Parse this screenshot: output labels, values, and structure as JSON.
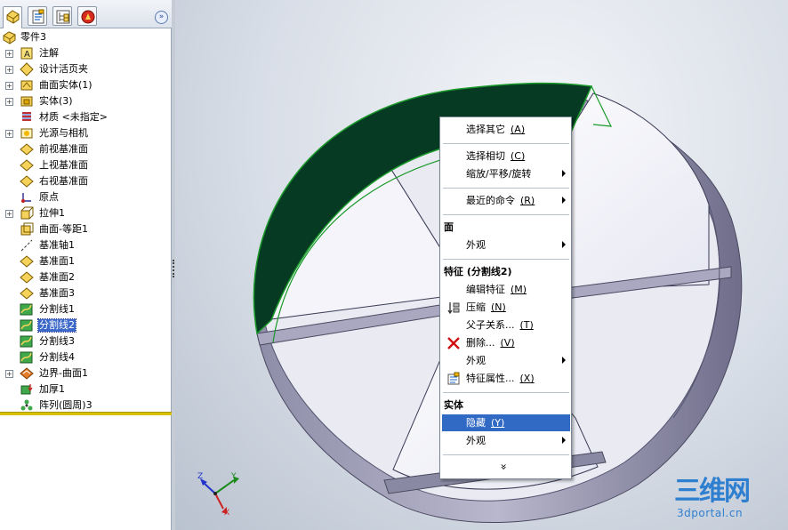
{
  "panel": {
    "tabs": [
      {
        "icon": "feature-manager-icon"
      },
      {
        "icon": "property-manager-icon"
      },
      {
        "icon": "configuration-manager-icon"
      },
      {
        "icon": "appearance-manager-icon"
      }
    ],
    "expand_glyph": "»",
    "tree": {
      "root": "零件3",
      "items": [
        {
          "label": "注解",
          "icon": "annotation-icon",
          "expandable": true
        },
        {
          "label": "设计活页夹",
          "icon": "design-binder-icon",
          "expandable": true
        },
        {
          "label": "曲面实体(1)",
          "icon": "surface-bodies-icon",
          "expandable": true
        },
        {
          "label": "实体(3)",
          "icon": "solid-bodies-icon",
          "expandable": true
        },
        {
          "label": "材质 <未指定>",
          "icon": "material-icon",
          "expandable": false
        },
        {
          "label": "光源与相机",
          "icon": "lights-cameras-icon",
          "expandable": true
        },
        {
          "label": "前视基准面",
          "icon": "plane-icon",
          "expandable": false
        },
        {
          "label": "上视基准面",
          "icon": "plane-icon",
          "expandable": false
        },
        {
          "label": "右视基准面",
          "icon": "plane-icon",
          "expandable": false
        },
        {
          "label": "原点",
          "icon": "origin-icon",
          "expandable": false
        },
        {
          "label": "拉伸1",
          "icon": "extrude-icon",
          "expandable": true
        },
        {
          "label": "曲面-等距1",
          "icon": "offset-surface-icon",
          "expandable": false
        },
        {
          "label": "基准轴1",
          "icon": "axis-icon",
          "expandable": false
        },
        {
          "label": "基准面1",
          "icon": "plane-icon",
          "expandable": false
        },
        {
          "label": "基准面2",
          "icon": "plane-icon",
          "expandable": false
        },
        {
          "label": "基准面3",
          "icon": "plane-icon",
          "expandable": false
        },
        {
          "label": "分割线1",
          "icon": "split-line-icon",
          "expandable": false
        },
        {
          "label": "分割线2",
          "icon": "split-line-icon",
          "expandable": false,
          "selected": true
        },
        {
          "label": "分割线3",
          "icon": "split-line-icon",
          "expandable": false
        },
        {
          "label": "分割线4",
          "icon": "split-line-icon",
          "expandable": false
        },
        {
          "label": "边界-曲面1",
          "icon": "boundary-surface-icon",
          "expandable": true
        },
        {
          "label": "加厚1",
          "icon": "thicken-icon",
          "expandable": false
        },
        {
          "label": "阵列(圆周)3",
          "icon": "circular-pattern-icon",
          "expandable": false
        }
      ]
    }
  },
  "triad": {
    "x": "X",
    "y": "Y",
    "z": "Z"
  },
  "context_menu": {
    "select_other": {
      "label": "选择其它",
      "accel": "(A)"
    },
    "select_tangency": {
      "label": "选择相切",
      "accel": "(C)"
    },
    "zoom_pan_rotate": {
      "label": "缩放/平移/旋转"
    },
    "recent_commands": {
      "label": "最近的命令",
      "accel": "(R)"
    },
    "face_section": "面",
    "face_appearance": {
      "label": "外观"
    },
    "feature_section": "特征 (分割线2)",
    "edit_feature": {
      "label": "编辑特征",
      "accel": "(M)"
    },
    "suppress": {
      "label": "压缩",
      "accel": "(N)"
    },
    "parent_child": {
      "label": "父子关系...",
      "accel": "(T)"
    },
    "delete": {
      "label": "删除...",
      "accel": "(V)"
    },
    "feature_appearance": {
      "label": "外观"
    },
    "feature_properties": {
      "label": "特征属性...",
      "accel": "(X)"
    },
    "body_section": "实体",
    "hide": {
      "label": "隐藏",
      "accel": "(Y)"
    },
    "body_appearance": {
      "label": "外观"
    },
    "more_glyph": "»"
  },
  "watermark": {
    "logo": "三维网",
    "url": "3dportal.cn"
  },
  "colors": {
    "selection": "#316ac5",
    "selected_face": "#063a23",
    "highlight_edge": "#1a9a2a",
    "model_gray": "#b7b6cc"
  }
}
